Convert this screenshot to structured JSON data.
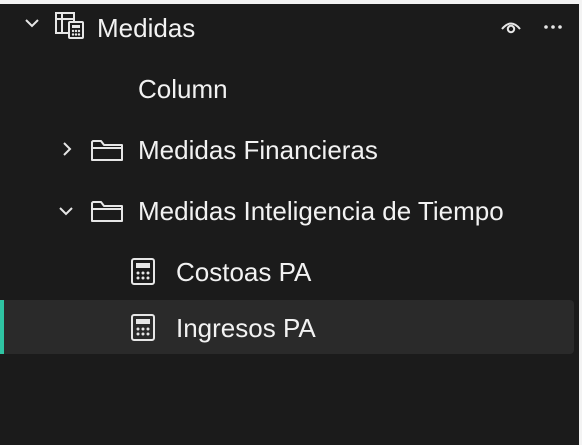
{
  "tree": {
    "root": {
      "label": "Medidas",
      "expanded": true,
      "icon": "table-calculator-icon",
      "actions": [
        "visibility-icon",
        "more-options-icon"
      ]
    },
    "items": [
      {
        "label": "Column",
        "type": "column"
      },
      {
        "label": "Medidas Financieras",
        "type": "folder",
        "expanded": false
      },
      {
        "label": "Medidas Inteligencia de Tiempo",
        "type": "folder",
        "expanded": true
      },
      {
        "label": "Costoas PA",
        "type": "measure"
      },
      {
        "label": "Ingresos PA",
        "type": "measure",
        "selected": true
      }
    ]
  },
  "colors": {
    "background": "#1b1b1b",
    "text": "#f2f2f2",
    "selection_background": "#2a2a2a",
    "selection_accent": "#2fc4a3"
  }
}
